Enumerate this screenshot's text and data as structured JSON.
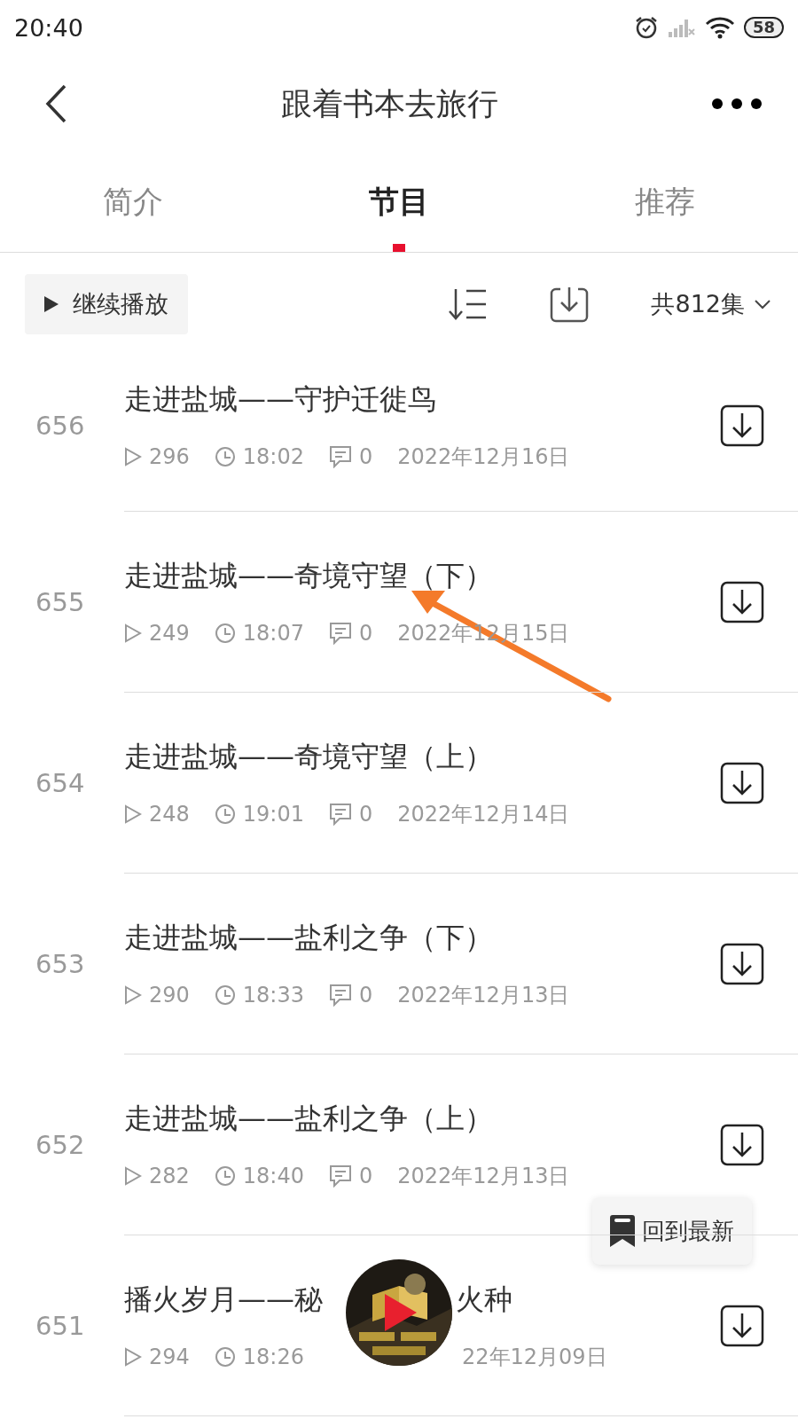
{
  "status_bar": {
    "time": "20:40",
    "battery": "58"
  },
  "header": {
    "title": "跟着书本去旅行"
  },
  "tabs": [
    {
      "label": "简介",
      "selected": false
    },
    {
      "label": "节目",
      "selected": true
    },
    {
      "label": "推荐",
      "selected": false
    }
  ],
  "toolbar": {
    "continue_button": "继续播放",
    "count": "共812集"
  },
  "episodes": [
    {
      "number": "656",
      "title": "走进盐城——守护迁徙鸟",
      "plays": "296",
      "duration": "18:02",
      "comments": "0",
      "date": "2022年12月16日"
    },
    {
      "number": "655",
      "title": "走进盐城——奇境守望（下）",
      "plays": "249",
      "duration": "18:07",
      "comments": "0",
      "date": "2022年12月15日"
    },
    {
      "number": "654",
      "title": "走进盐城——奇境守望（上）",
      "plays": "248",
      "duration": "19:01",
      "comments": "0",
      "date": "2022年12月14日"
    },
    {
      "number": "653",
      "title": "走进盐城——盐利之争（下）",
      "plays": "290",
      "duration": "18:33",
      "comments": "0",
      "date": "2022年12月13日"
    },
    {
      "number": "652",
      "title": "走进盐城——盐利之争（上）",
      "plays": "282",
      "duration": "18:40",
      "comments": "0",
      "date": "2022年12月13日"
    },
    {
      "number": "651",
      "title": "播火岁月——秘",
      "title_after": "火种",
      "plays": "294",
      "duration": "18:26",
      "date": "22年12月09日"
    }
  ],
  "back_to_latest": "回到最新"
}
